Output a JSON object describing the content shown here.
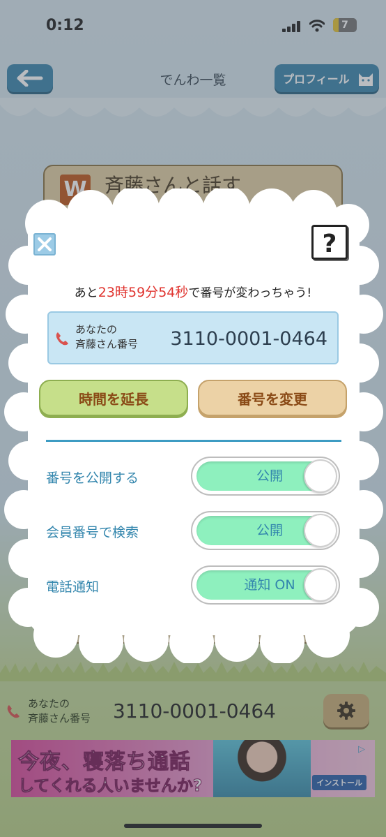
{
  "status_bar": {
    "time": "0:12",
    "battery": "7"
  },
  "header": {
    "title": "でんわ一覧",
    "profile_label": "プロフィール"
  },
  "background_card": {
    "badge": "W",
    "title": "斉藤さんと話す"
  },
  "footer": {
    "label_line1": "あなたの",
    "label_line2": "斉藤さん番号",
    "number": "3110-0001-0464"
  },
  "ad": {
    "line1": "今夜、寝落ち通話",
    "line2": "してくれる人いませんか?",
    "install": "インストール"
  },
  "modal": {
    "help": "?",
    "countdown": {
      "prefix": "あと",
      "hours": "23",
      "hours_unit": "時",
      "minutes": "59",
      "minutes_unit": "分",
      "seconds": "54",
      "seconds_unit": "秒",
      "suffix": "で番号が変わっちゃう!"
    },
    "number_box": {
      "label_line1": "あなたの",
      "label_line2": "斉藤さん番号",
      "number": "3110-0001-0464"
    },
    "extend_label": "時間を延長",
    "change_label": "番号を変更",
    "settings": [
      {
        "label": "番号を公開する",
        "toggle": "公開",
        "on": true
      },
      {
        "label": "会員番号で検索",
        "toggle": "公開",
        "on": true
      },
      {
        "label": "電話通知",
        "toggle": "通知 ON",
        "on": true
      }
    ]
  },
  "colors": {
    "accent_blue": "#3386ad",
    "countdown_red": "#e0342f",
    "toggle_on": "#8ef0be",
    "extend_green": "#c6df8a",
    "change_tan": "#ecd2a6"
  }
}
